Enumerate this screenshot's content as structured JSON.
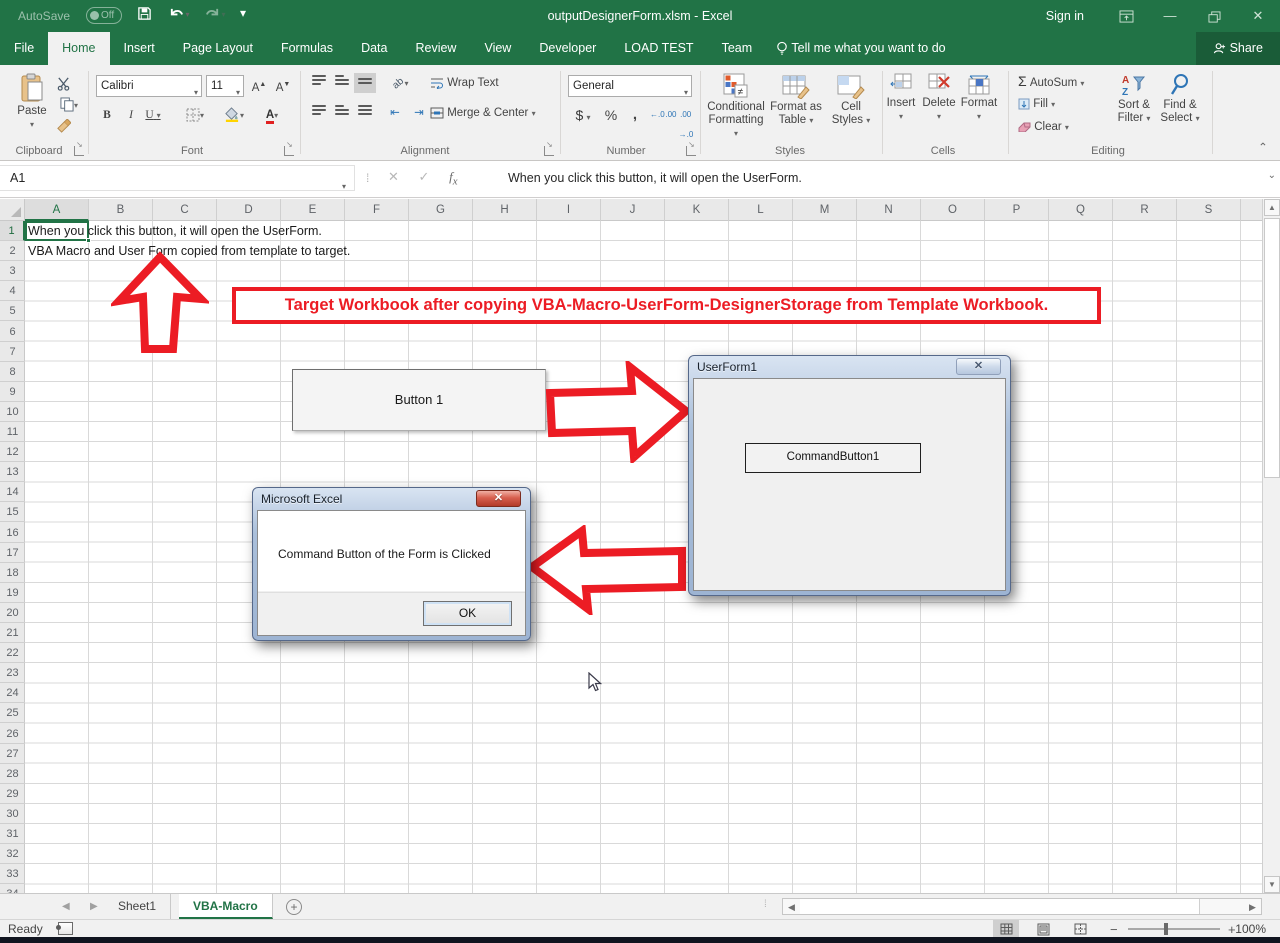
{
  "accent": "#217346",
  "annotation_red": "#ec1c24",
  "titlebar": {
    "autosave_label": "AutoSave",
    "autosave_state": "Off",
    "title": "outputDesignerForm.xlsm  -  Excel",
    "sign_in": "Sign in"
  },
  "ribbon_tabs": {
    "active": "Home",
    "items": [
      "File",
      "Home",
      "Insert",
      "Page Layout",
      "Formulas",
      "Data",
      "Review",
      "View",
      "Developer",
      "LOAD TEST",
      "Team"
    ],
    "tell_me": "Tell me what you want to do",
    "share": "Share"
  },
  "ribbon": {
    "clipboard": {
      "paste": "Paste",
      "label": "Clipboard"
    },
    "font": {
      "name": "Calibri",
      "size": "11",
      "bold": "B",
      "italic": "I",
      "underline": "U",
      "label": "Font"
    },
    "alignment": {
      "wrap_text": "Wrap Text",
      "merge_center": "Merge & Center",
      "label": "Alignment"
    },
    "number": {
      "format": "General",
      "currency": "$",
      "percent": "%",
      "comma": ",",
      "inc_dec": "←.0 .00",
      "dec_dec": ".00 →.0",
      "label": "Number"
    },
    "styles": {
      "conditional": "Conditional Formatting",
      "format_table": "Format as Table",
      "cell_styles": "Cell Styles",
      "label": "Styles"
    },
    "cells": {
      "insert": "Insert",
      "delete": "Delete",
      "format": "Format",
      "label": "Cells"
    },
    "editing": {
      "autosum": "AutoSum",
      "fill": "Fill",
      "clear": "Clear",
      "sort": "Sort & Filter",
      "find": "Find & Select",
      "label": "Editing"
    }
  },
  "formula_bar": {
    "name_box": "A1",
    "formula": "When you click this button, it will open the UserForm."
  },
  "grid": {
    "columns": [
      "A",
      "B",
      "C",
      "D",
      "E",
      "F",
      "G",
      "H",
      "I",
      "J",
      "K",
      "L",
      "M",
      "N",
      "O",
      "P",
      "Q",
      "R",
      "S"
    ],
    "row_count": 34,
    "selected_column": "A",
    "selected_row": "1",
    "cells": {
      "a1": "When you click this button, it will open the UserForm.",
      "a2": "VBA Macro and User Form copied from template to target."
    }
  },
  "annotations": {
    "banner": "Target Workbook after copying VBA-Macro-UserForm-DesignerStorage from Template Workbook."
  },
  "sheet_button": {
    "label": "Button 1"
  },
  "userform": {
    "title": "UserForm1",
    "command_button": "CommandButton1",
    "close_glyph": "✕"
  },
  "msgbox": {
    "title": "Microsoft Excel",
    "message": "Command Button of the Form is Clicked",
    "ok": "OK",
    "close_glyph": "✕"
  },
  "sheet_tabs": {
    "items": [
      "Sheet1",
      "VBA-Macro"
    ],
    "active": "VBA-Macro"
  },
  "status_bar": {
    "mode": "Ready",
    "zoom": "100%"
  }
}
